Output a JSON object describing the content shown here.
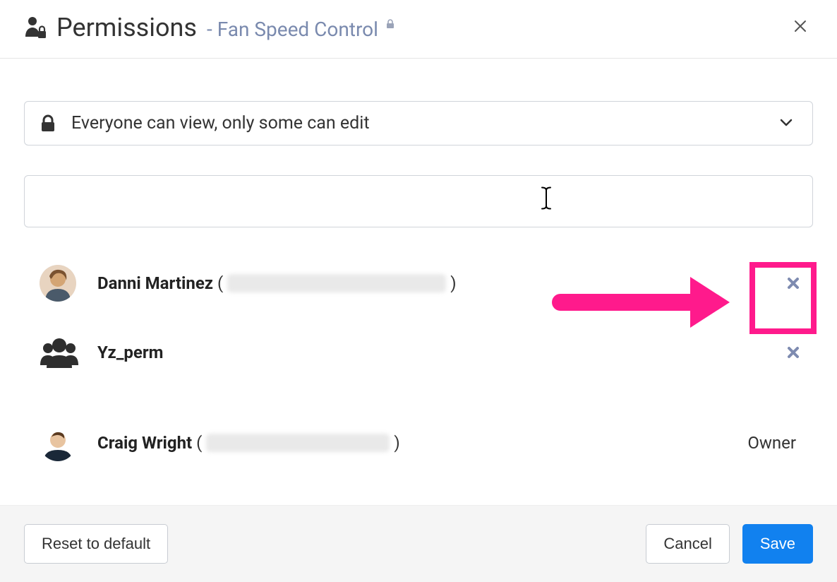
{
  "header": {
    "title": "Permissions",
    "separator": "-",
    "subtitle": "Fan Speed Control"
  },
  "dropdown": {
    "label": "Everyone can view, only some can edit"
  },
  "search": {
    "value": ""
  },
  "users": [
    {
      "name": "Danni Martinez",
      "email_hidden": true,
      "role": "member"
    },
    {
      "name": "Yz_perm",
      "type": "group",
      "role": "member"
    },
    {
      "name": "Craig Wright",
      "email_hidden": true,
      "role": "owner",
      "owner_label": "Owner"
    }
  ],
  "footer": {
    "reset": "Reset to default",
    "cancel": "Cancel",
    "save": "Save"
  },
  "colors": {
    "primary": "#1181ef",
    "annotation": "#ff1a8c",
    "subtitle": "#7a8aae",
    "remove_icon": "#7e8bb0"
  }
}
